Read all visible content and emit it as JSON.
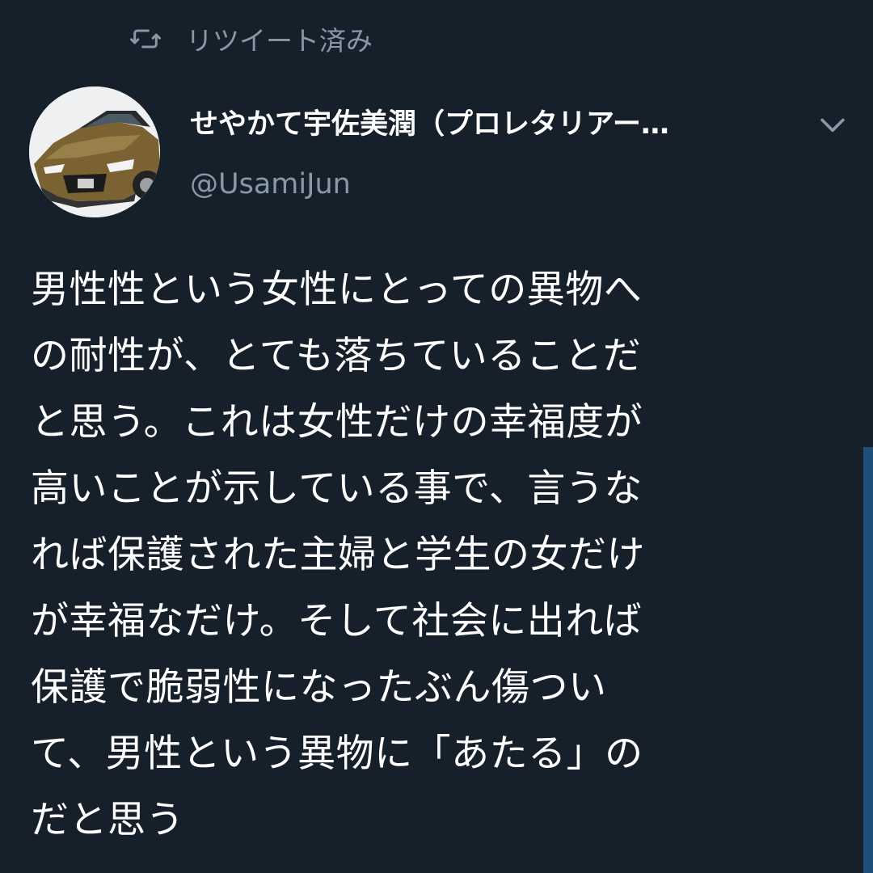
{
  "retweet": {
    "icon": "retweet-icon",
    "label": "リツイート済み"
  },
  "author": {
    "avatar_icon": "car-avatar",
    "display_name": "せやかて宇佐美潤（プロレタリアー…",
    "handle": "@UsamiJun"
  },
  "menu": {
    "icon": "chevron-down-icon"
  },
  "tweet": {
    "lines": [
      "男性性という女性にとっての異物へ",
      "の耐性が、とても落ちていることだ",
      "と思う。これは女性だけの幸福度が",
      "高いことが示している事で、言うな",
      "れば保護された主婦と学生の女だけ",
      "が幸福なだけ。そして社会に出れば",
      "保護で脆弱性になったぶん傷つい",
      "て、男性という異物に「あたる」の",
      "だと思う"
    ]
  },
  "colors": {
    "background": "#15202b",
    "text": "#ffffff",
    "secondary": "#8899a6",
    "scroll": "#1d4f78"
  }
}
